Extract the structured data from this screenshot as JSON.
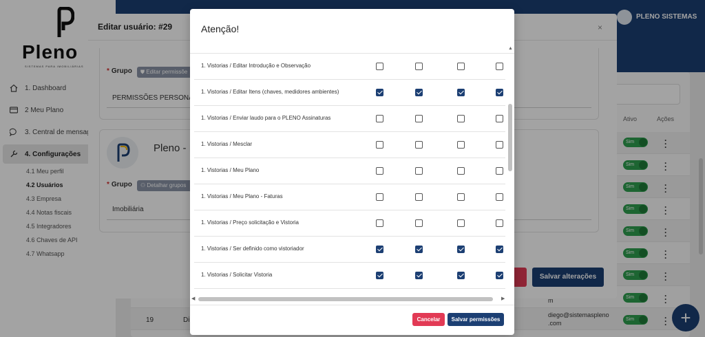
{
  "app": {
    "brand": "Pleno",
    "brand_sub": "SISTEMAS PARA IMOBILIÁRIAS",
    "user_name": "PLENO SISTEMAS"
  },
  "sidebar": {
    "items": [
      {
        "label": "1. Dashboard",
        "icon": "home-icon"
      },
      {
        "label": "2 Meu Plano",
        "icon": "card-icon"
      },
      {
        "label": "3. Central de mensag",
        "icon": "chat-icon"
      },
      {
        "label": "4. Configurações",
        "icon": "wrench-icon"
      }
    ],
    "sub_items": [
      {
        "label": "4.1 Meu perfil"
      },
      {
        "label": "4.2 Usuários"
      },
      {
        "label": "4.3 Empresa"
      },
      {
        "label": "4.4 Notas fiscais"
      },
      {
        "label": "4.5 Integradores"
      },
      {
        "label": "4.6 Chaves de API"
      },
      {
        "label": "4.7 Whatsapp"
      }
    ]
  },
  "table": {
    "col_ativo": "Ativo",
    "col_acoes": "Ações",
    "toggle_label": "Sim",
    "row_id": "19",
    "row_prefix": "Di",
    "email_fragment": "m",
    "email_line1": "diego@sistemaspleno",
    "email_line2": ".com"
  },
  "edit_modal": {
    "title": "Editar usuário: #29",
    "close": "×",
    "card1": {
      "grupo_label": "Grupo",
      "chip": "Editar permissõe",
      "value": "PERMISSÕES PERSONAL"
    },
    "card2": {
      "title": "Pleno - F",
      "grupo_label": "Grupo",
      "chip": "Detalhar grupos",
      "value": "Imobiliária"
    },
    "save_label": "Salvar alterações"
  },
  "attention_modal": {
    "title": "Atenção!",
    "rows": [
      {
        "label": "1. Vistorias / Editar Introdução e Observação",
        "checks": [
          false,
          false,
          false,
          false
        ]
      },
      {
        "label": "1. Vistorias / Editar Itens (chaves, medidores ambientes)",
        "checks": [
          true,
          true,
          true,
          true
        ]
      },
      {
        "label": "1. Vistorias / Enviar laudo para o PLENO Assinaturas",
        "checks": [
          false,
          false,
          false,
          false
        ]
      },
      {
        "label": "1. Vistorias / Mesclar",
        "checks": [
          false,
          false,
          false,
          false
        ]
      },
      {
        "label": "1. Vistorias / Meu Plano",
        "checks": [
          false,
          false,
          false,
          false
        ]
      },
      {
        "label": "1. Vistorias / Meu Plano - Faturas",
        "checks": [
          false,
          false,
          false,
          false
        ]
      },
      {
        "label": "1. Vistorias / Preço solicitação e Vistoria",
        "checks": [
          false,
          false,
          false,
          false
        ]
      },
      {
        "label": "1. Vistorias / Ser definido como vistoriador",
        "checks": [
          true,
          true,
          true,
          true
        ]
      },
      {
        "label": "1. Vistorias / Solicitar Vistoria",
        "checks": [
          true,
          true,
          true,
          true
        ]
      }
    ],
    "cancel_label": "Cancelar",
    "save_label": "Salvar permissões"
  },
  "colors": {
    "primary": "#1c3f73",
    "danger": "#e23a55",
    "success": "#2e9e4f"
  }
}
